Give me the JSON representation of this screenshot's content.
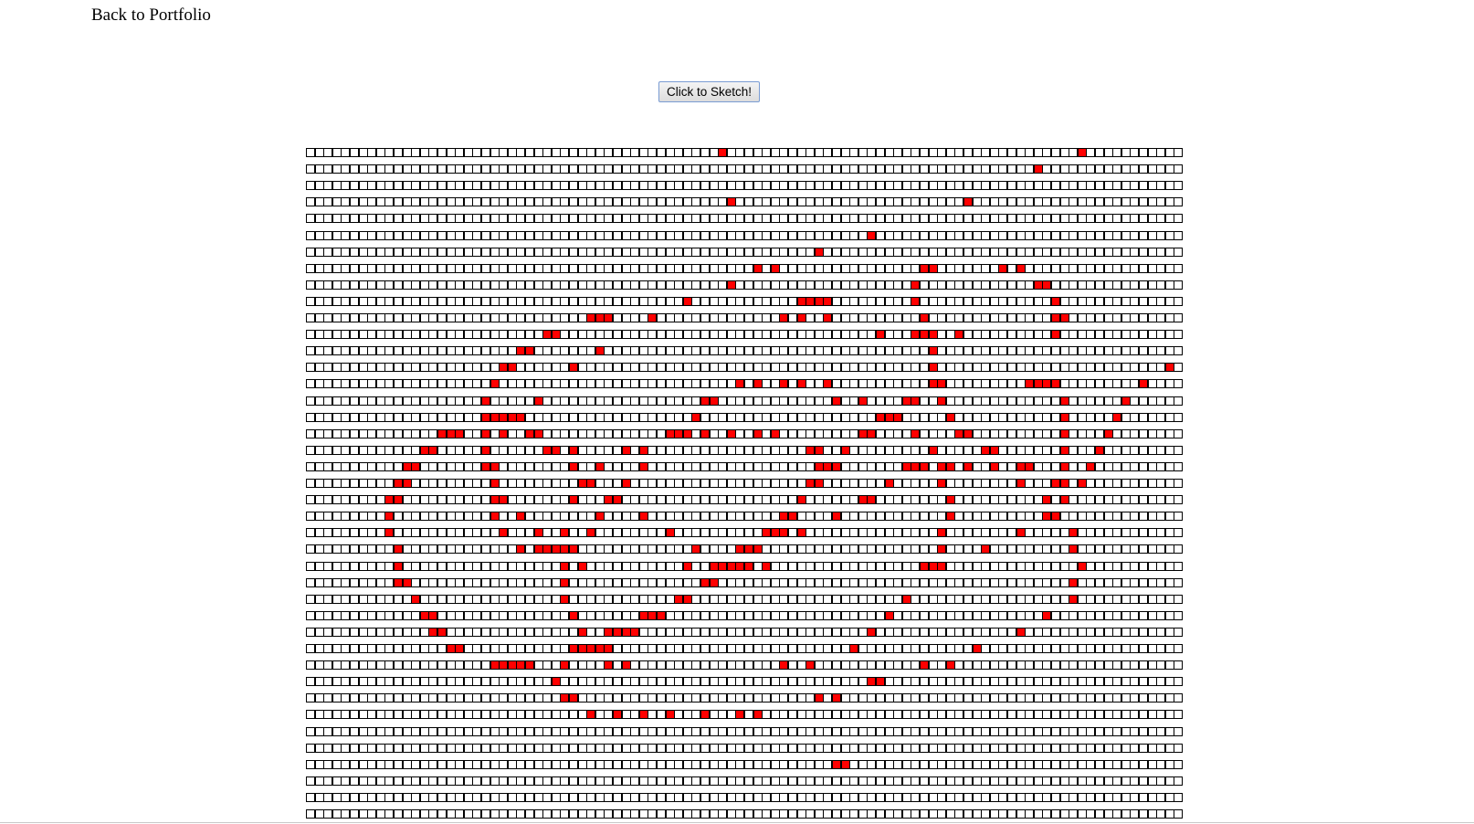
{
  "nav": {
    "back_label": "Back to Portfolio"
  },
  "controls": {
    "sketch_label": "Click to Sketch!"
  },
  "colors": {
    "cell_off": "#ffffff",
    "cell_on": "#ff0000",
    "cell_border": "#000000"
  },
  "grid": {
    "columns": 100,
    "rows": 41,
    "filled": [
      [
        47,
        88
      ],
      [
        83
      ],
      [],
      [
        48,
        75
      ],
      [],
      [
        64
      ],
      [
        58
      ],
      [
        51,
        53,
        70,
        71,
        79,
        81
      ],
      [
        48,
        69,
        83,
        84
      ],
      [
        43,
        56,
        57,
        58,
        59,
        69,
        85
      ],
      [
        32,
        33,
        34,
        39,
        54,
        56,
        59,
        70,
        85,
        86
      ],
      [
        27,
        28,
        65,
        69,
        70,
        71,
        74,
        85
      ],
      [
        24,
        25,
        33,
        71
      ],
      [
        22,
        23,
        30,
        71,
        98
      ],
      [
        21,
        49,
        51,
        54,
        56,
        59,
        71,
        72,
        82,
        83,
        84,
        85,
        95
      ],
      [
        20,
        26,
        45,
        46,
        60,
        63,
        68,
        69,
        72,
        86,
        93
      ],
      [
        20,
        21,
        22,
        23,
        24,
        44,
        65,
        66,
        67,
        73,
        86,
        92
      ],
      [
        15,
        16,
        17,
        20,
        22,
        25,
        26,
        41,
        42,
        43,
        45,
        48,
        51,
        53,
        63,
        64,
        69,
        74,
        75,
        86,
        91
      ],
      [
        13,
        14,
        20,
        27,
        28,
        30,
        36,
        38,
        57,
        58,
        61,
        71,
        77,
        78,
        86,
        90
      ],
      [
        11,
        12,
        20,
        21,
        30,
        33,
        38,
        58,
        59,
        60,
        68,
        69,
        70,
        72,
        73,
        75,
        78,
        81,
        82,
        86,
        89
      ],
      [
        10,
        11,
        21,
        31,
        32,
        36,
        57,
        58,
        66,
        72,
        81,
        85,
        86,
        88
      ],
      [
        9,
        10,
        21,
        22,
        30,
        34,
        35,
        56,
        63,
        64,
        73,
        84,
        86
      ],
      [
        9,
        21,
        24,
        33,
        38,
        54,
        55,
        60,
        73,
        84,
        85
      ],
      [
        9,
        22,
        26,
        29,
        32,
        41,
        52,
        53,
        54,
        56,
        72,
        81,
        87
      ],
      [
        10,
        24,
        26,
        27,
        28,
        29,
        30,
        44,
        49,
        50,
        51,
        72,
        77,
        87
      ],
      [
        10,
        29,
        31,
        43,
        46,
        47,
        48,
        49,
        50,
        52,
        70,
        71,
        72,
        88
      ],
      [
        10,
        11,
        29,
        45,
        46,
        87
      ],
      [
        12,
        29,
        42,
        43,
        68,
        87
      ],
      [
        13,
        14,
        30,
        38,
        39,
        40,
        66,
        84
      ],
      [
        14,
        15,
        31,
        34,
        35,
        36,
        37,
        64,
        81
      ],
      [
        16,
        17,
        30,
        31,
        32,
        33,
        34,
        62,
        76
      ],
      [
        21,
        22,
        23,
        24,
        25,
        29,
        34,
        36,
        54,
        57,
        70,
        73
      ],
      [
        28,
        64,
        65
      ],
      [
        29,
        30,
        58,
        60
      ],
      [
        32,
        35,
        38,
        41,
        45,
        49,
        51
      ],
      [],
      [],
      [
        60,
        61
      ],
      [],
      [],
      []
    ]
  }
}
